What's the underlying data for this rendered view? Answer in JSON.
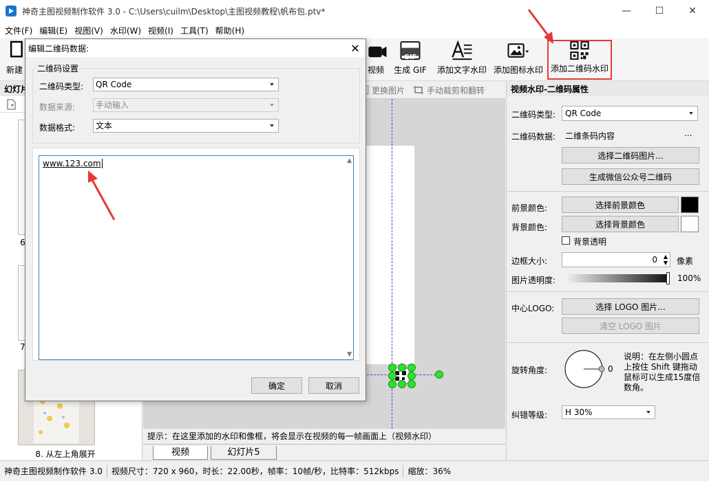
{
  "window": {
    "title": "神奇主图视频制作软件 3.0 - C:\\Users\\cuilm\\Desktop\\主图视频教程\\帆布包.ptv*",
    "minimize": "—",
    "maximize": "☐",
    "close": "✕"
  },
  "menu": [
    "文件(F)",
    "编辑(E)",
    "视图(V)",
    "水印(W)",
    "视频(I)",
    "工具(T)",
    "帮助(H)"
  ],
  "toolbar": {
    "new_label": "新建",
    "video_label": "视频",
    "gif_label": "生成 GIF",
    "gif_text": "GIF",
    "text_wm_label": "添加文字水印",
    "icon_wm_label": "添加图标水印",
    "qr_wm_label": "添加二维码水印"
  },
  "left_panel": {
    "header": "幻灯片",
    "slide_label": "8. 从左上角展开",
    "numbers": [
      "6",
      "7"
    ]
  },
  "canvas": {
    "replace_image": "更换图片",
    "crop_flip": "手动裁剪和翻转",
    "hint": "提示：在这里添加的水印和像框，将会显示在视频的每一帧画面上（视频水印）"
  },
  "tabs": [
    "视频",
    "幻灯片5"
  ],
  "right_panel": {
    "header": "视频水印-二维码属性",
    "qr_type_label": "二维码类型:",
    "qr_type_value": "QR Code",
    "qr_data_label": "二维码数据:",
    "qr_data_value": "二维条码内容",
    "qr_data_more": "...",
    "select_qr_image": "选择二维码图片...",
    "gen_wechat_qr": "生成微信公众号二维码",
    "fg_color_label": "前景颜色:",
    "fg_color_btn": "选择前景颜色",
    "fg_color": "#000000",
    "bg_color_label": "背景颜色:",
    "bg_color_btn": "选择背景颜色",
    "bg_color": "#ffffff",
    "bg_transparent": "背景透明",
    "border_label": "边框大小:",
    "border_value": "0",
    "border_unit": "像素",
    "opacity_label": "图片透明度:",
    "opacity_value": "100%",
    "logo_label": "中心LOGO:",
    "select_logo": "选择 LOGO 图片...",
    "clear_logo": "清空  LOGO 图片",
    "rotate_label": "旋转角度:",
    "rotate_value": "0",
    "rotate_note": "说明：在左侧小圆点上按住 Shift 键拖动鼠标可以生成15度倍数角。",
    "ecc_label": "纠错等级:",
    "ecc_value": "H 30%"
  },
  "status": {
    "app": "神奇主图视频制作软件 3.0",
    "info": "视频尺寸：720 x 960，时长：22.00秒，帧率：10帧/秒，比特率：512kbps",
    "zoom": "缩放：36%"
  },
  "dialog": {
    "title": "编辑二维码数据:",
    "close": "✕",
    "group_title": "二维码设置",
    "type_label": "二维码类型:",
    "type_value": "QR Code",
    "source_label": "数据来源:",
    "source_value": "手动输入",
    "format_label": "数据格式:",
    "format_value": "文本",
    "text_value": "www.123.com",
    "ok": "确定",
    "cancel": "取消"
  },
  "colors": {
    "highlight": "#e53935",
    "accent": "#1677d2",
    "handle": "#33dd33"
  }
}
